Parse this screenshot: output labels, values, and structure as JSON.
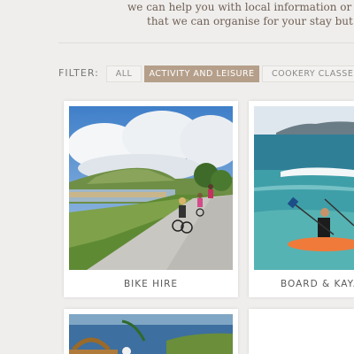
{
  "intro": {
    "line1": "we can help you with local information or book things for",
    "line2": "that we can organise for your stay but please call or"
  },
  "filter": {
    "label": "FILTER:",
    "options": [
      "ALL",
      "ACTIVITY AND LEISURE",
      "COOKERY CLASSES"
    ],
    "active": "ACTIVITY AND LEISURE"
  },
  "cards": [
    {
      "caption": "BIKE HIRE",
      "image": "cyclists-on-coastal-path-photo"
    },
    {
      "caption": "BOARD & KAYA",
      "image": "kayakers-at-beach-photo"
    },
    {
      "caption": "",
      "image": "picnic-basket-by-sea-photo"
    },
    {
      "caption": "",
      "image": "blank-photo"
    }
  ],
  "colors": {
    "accent": "#b59f8a",
    "background": "#efeeec",
    "intro_text": "#6f5f55"
  }
}
